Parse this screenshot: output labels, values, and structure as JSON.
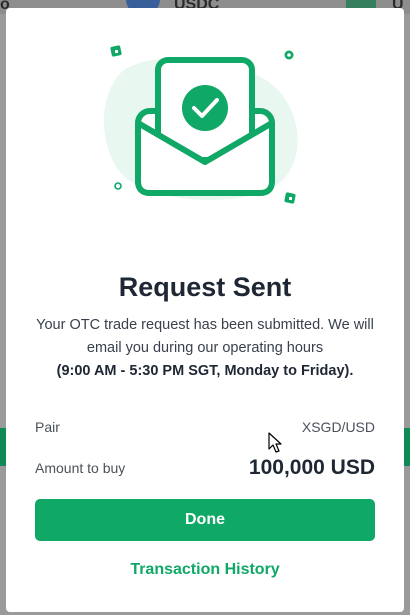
{
  "background": {
    "top_left_text": "o",
    "top_text": "USDC",
    "top_right_text": "U"
  },
  "modal": {
    "illustration": {
      "icon": "envelope-check-icon",
      "accent_color": "#10a866",
      "tint_color": "#e8f7ef"
    },
    "title": "Request Sent",
    "description": "Your OTC trade request has been submitted. We will email you during our operating hours",
    "hours": "(9:00 AM - 5:30 PM SGT, Monday to Friday).",
    "pair_label": "Pair",
    "pair_value": "XSGD/USD",
    "amount_label": "Amount to buy",
    "amount_value": "100,000 USD",
    "done_label": "Done",
    "history_label": "Transaction History"
  },
  "colors": {
    "primary": "#10a866",
    "text_dark": "#1e2733",
    "text_muted": "#4a525c"
  }
}
